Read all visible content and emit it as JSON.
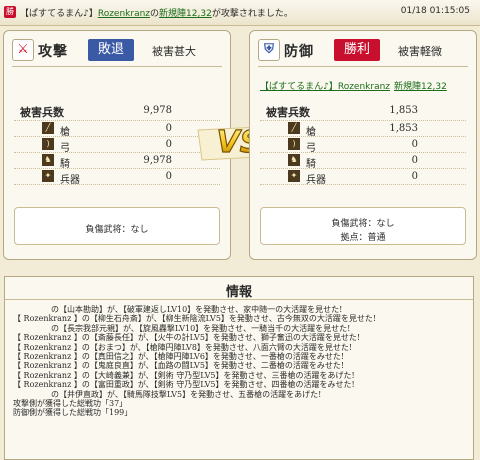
{
  "topbar": {
    "tag": "勝",
    "message_prefix": "【ぱすてるまん♪】",
    "message_player": "Rozenkranz",
    "message_mid": "の",
    "message_village": "新規陣12,32",
    "message_suffix": "が攻撃されました。",
    "timestamp": "01/18 01:15:05"
  },
  "attack": {
    "icon": "swords-icon",
    "kind": "攻撃",
    "result": "敗退",
    "damage": "被害甚大",
    "casualties_label": "被害兵数",
    "casualties_total": "9,978",
    "units": [
      {
        "name": "槍",
        "value": "0"
      },
      {
        "name": "弓",
        "value": "0"
      },
      {
        "name": "騎",
        "value": "9,978"
      },
      {
        "name": "兵器",
        "value": "0"
      }
    ],
    "wounded_label": "負傷武将：なし"
  },
  "defense": {
    "icon": "shield-icon",
    "kind": "防御",
    "result": "勝利",
    "damage": "被害軽微",
    "owner_prefix": "【ぱすてるまん♪】",
    "owner_player": "Rozenkranz",
    "owner_village": "新規陣12,32",
    "casualties_label": "被害兵数",
    "casualties_total": "1,853",
    "units": [
      {
        "name": "槍",
        "value": "1,853"
      },
      {
        "name": "弓",
        "value": "0"
      },
      {
        "name": "騎",
        "value": "0"
      },
      {
        "name": "兵器",
        "value": "0"
      }
    ],
    "wounded_label": "負傷武将：なし",
    "base_label": "拠点：普通"
  },
  "vs_label": "VS",
  "info": {
    "title": "情報",
    "lines": [
      "の【山本勘助】が、【破軍建返しLV10】を発動させ、家中随一の大活躍を見せた!",
      "【 Rozenkranz 】の【柳生石舟斎】が、【柳生新陰流LV5】を発動させ、古今無双の大活躍を見せた!",
      "の【長宗我部元親】が、【旋風轟撃LV10】を発動させ、一騎当千の大活躍を見せた!",
      "【 Rozenkranz 】の【斎藤長任】が、【火牛の計LV5】を発動させ、獅子奮迅の大活躍を見せた!",
      "【 Rozenkranz 】の【おまつ】が、【槍陣円陣LV8】を発動させ、八面六臂の大活躍を見せた!",
      "【 Rozenkranz 】の【真田信之】が、【槍陣円陣LV6】を発動させ、一番槍の活躍をみせた!",
      "【 Rozenkranz 】の【鬼庭良直】が、【血路の闘LV5】を発動させ、二番槍の活躍をみせた!",
      "【 Rozenkranz 】の【大崎義兼】が、【剣術 守乃型LV5】を発動させ、三番槍の活躍をあげた!",
      "【 Rozenkranz 】の【富田重政】が、【剣術 守乃型LV5】を発動させ、四番槍の活躍をみせた!",
      "の【井伊直政】が、【騎馬隊技撃LV5】を発動させ、五番槍の活躍をあげた!",
      "攻撃側が獲得した総戦功「37」",
      "防御側が獲得した総戦功「199」"
    ]
  }
}
